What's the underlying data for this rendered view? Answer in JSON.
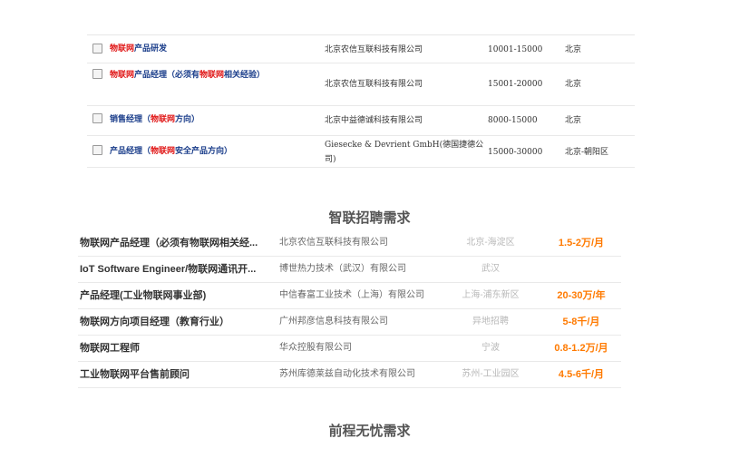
{
  "table1": {
    "rows": [
      {
        "job_parts": [
          "物联网",
          "产品研发"
        ],
        "company": "北京农信互联科技有限公司",
        "salary": "10001-15000",
        "location": "北京"
      },
      {
        "job_parts": [
          "物联网",
          "产品经理（必须有",
          "物联网",
          "相关经验）"
        ],
        "company": "北京农信互联科技有限公司",
        "salary": "15001-20000",
        "location": "北京"
      },
      {
        "job_parts": [
          "",
          "销售经理（",
          "物联网",
          "方向）"
        ],
        "company": "北京中益德诚科技有限公司",
        "salary": "8000-15000",
        "location": "北京"
      },
      {
        "job_parts": [
          "",
          "产品经理（",
          "物联网",
          "安全产品方向）"
        ],
        "company": "Giesecke & Devrient GmbH(德国捷德公司)",
        "salary": "15000-30000",
        "location": "北京-朝阳区"
      }
    ]
  },
  "section_title_1": "智联招聘需求",
  "table2": {
    "rows": [
      {
        "job": "物联网产品经理（必须有物联网相关经...",
        "company": "北京农信互联科技有限公司",
        "location": "北京-海淀区",
        "salary": "1.5-2万/月"
      },
      {
        "job": "IoT Software Engineer/物联网通讯开...",
        "company": "博世热力技术（武汉）有限公司",
        "location": "武汉",
        "salary": ""
      },
      {
        "job": "产品经理(工业物联网事业部)",
        "company": "中信春富工业技术（上海）有限公司",
        "location": "上海-浦东新区",
        "salary": "20-30万/年"
      },
      {
        "job": "物联网方向项目经理（教育行业）",
        "company": "广州邦彦信息科技有限公司",
        "location": "异地招聘",
        "salary": "5-8千/月"
      },
      {
        "job": "物联网工程师",
        "company": "华众控股有限公司",
        "location": "宁波",
        "salary": "0.8-1.2万/月"
      },
      {
        "job": "工业物联网平台售前顾问",
        "company": "苏州库德莱兹自动化技术有限公司",
        "location": "苏州-工业园区",
        "salary": "4.5-6千/月"
      }
    ]
  },
  "section_title_2": "前程无忧需求"
}
